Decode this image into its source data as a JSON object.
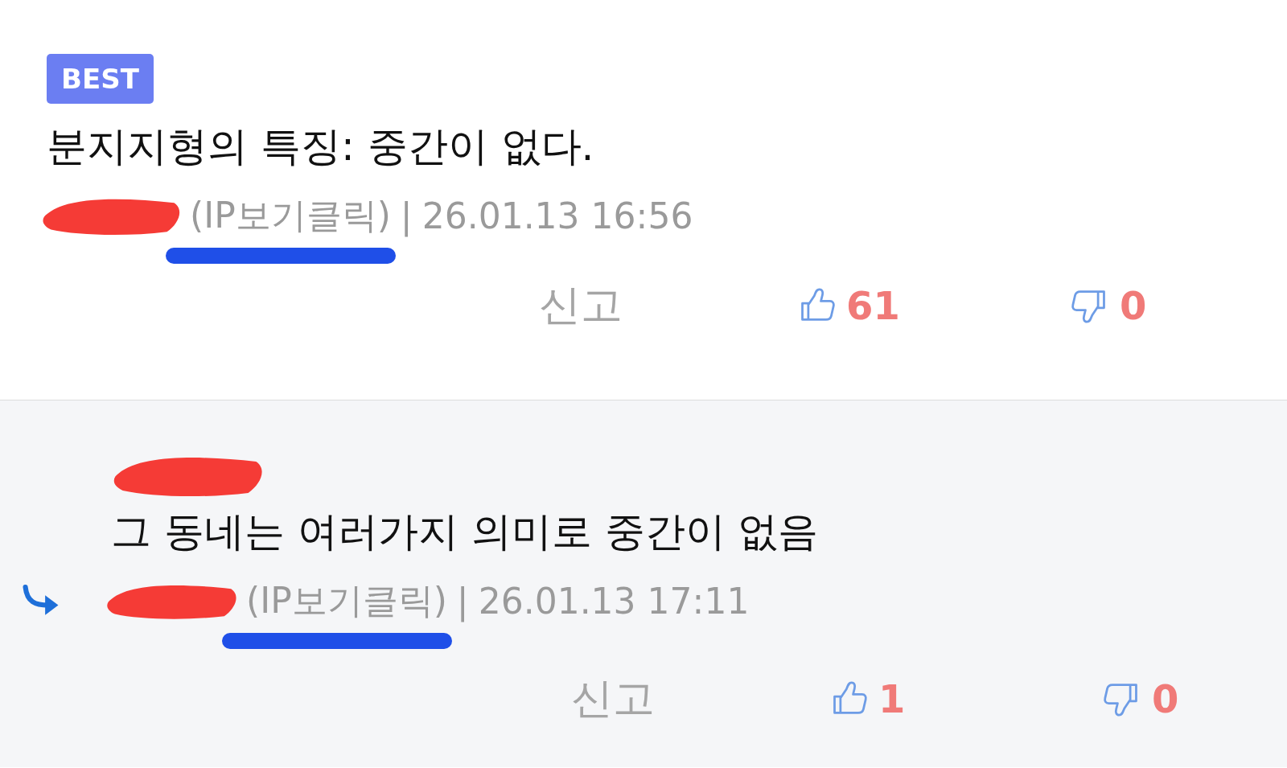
{
  "comments": [
    {
      "kind": "best",
      "badge": "BEST",
      "text": "분지지형의 특징: 중간이 없다.",
      "ip_label": "(IP보기클릭)",
      "separator": "|",
      "timestamp": "26.01.13 16:56",
      "report_label": "신고",
      "likes": "61",
      "dislikes": "0"
    },
    {
      "kind": "reply",
      "text": "그 동네는 여러가지 의미로 중간이 없음",
      "ip_label": "(IP보기클릭)",
      "separator": "|",
      "timestamp": "26.01.13 17:11",
      "report_label": "신고",
      "likes": "1",
      "dislikes": "0"
    }
  ]
}
